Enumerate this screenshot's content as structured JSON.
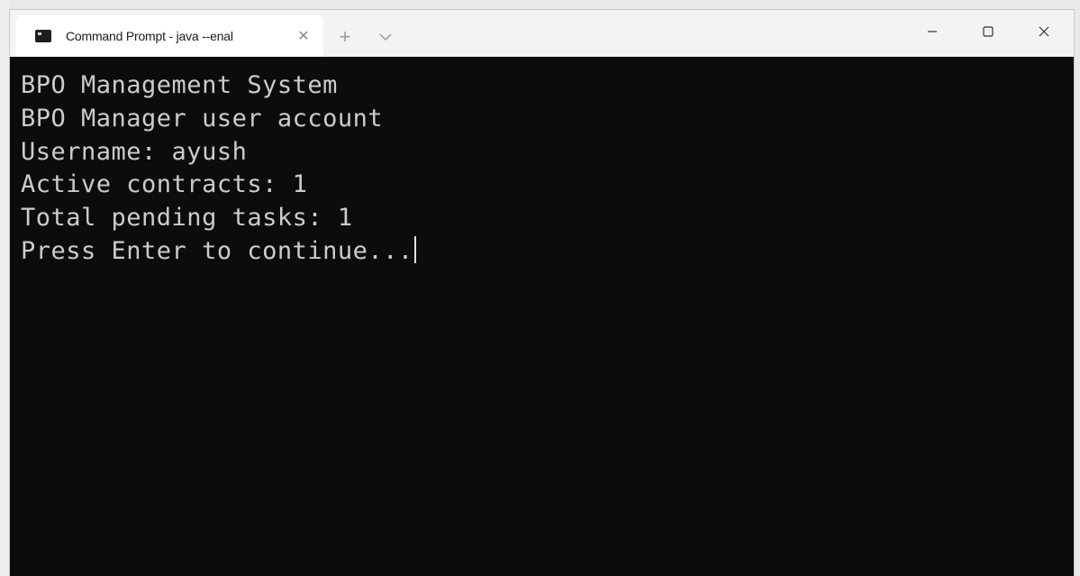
{
  "tab": {
    "title": "Command Prompt - java  --enal",
    "icon": "terminal-icon"
  },
  "titlebar": {
    "new_tab_symbol": "+",
    "close_tab_symbol": "✕"
  },
  "terminal": {
    "lines": [
      "BPO Management System",
      "BPO Manager user account",
      "Username: ayush",
      "Active contracts: 1",
      "Total pending tasks: 1",
      "Press Enter to continue..."
    ]
  },
  "colors": {
    "terminal_bg": "#0c0c0c",
    "terminal_fg": "#cccccc",
    "titlebar_bg": "#f3f3f3",
    "tab_bg": "#ffffff"
  }
}
